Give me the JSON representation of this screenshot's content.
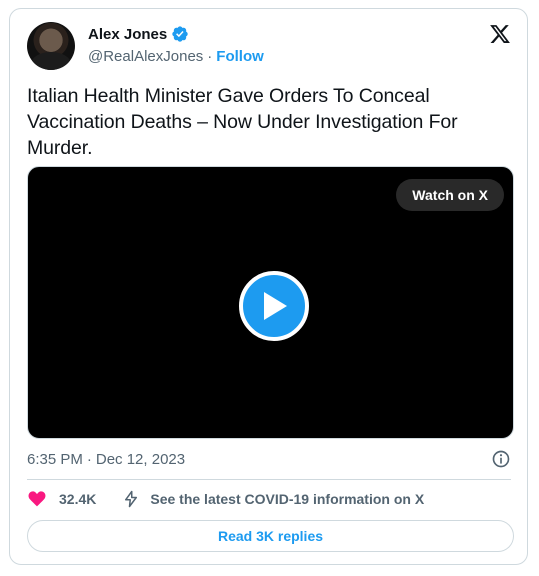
{
  "author": {
    "name": "Alex Jones",
    "handle": "@RealAlexJones",
    "separator": "·",
    "follow_label": "Follow"
  },
  "tweet": {
    "text": "Italian Health Minister Gave Orders To Conceal Vaccination Deaths – Now Under Investigation For Murder.",
    "time": "6:35 PM",
    "separator": "·",
    "date": "Dec 12, 2023"
  },
  "video": {
    "watch_label": "Watch on X"
  },
  "actions": {
    "likes": "32.4K",
    "covid_info": "See the latest COVID-19 information on X",
    "replies_label": "Read 3K replies"
  },
  "colors": {
    "accent": "#1d9bf0",
    "like": "#f91880",
    "text": "#0f1419",
    "muted": "#536471",
    "border": "#cfd9de"
  },
  "icons": [
    "verified-badge-icon",
    "x-logo-icon",
    "play-icon",
    "info-icon",
    "heart-icon",
    "lightning-icon"
  ]
}
